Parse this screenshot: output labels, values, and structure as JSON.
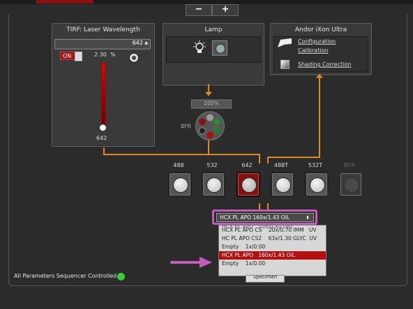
{
  "colors": {
    "accent": "#e08a1e",
    "highlight": "#c35dbb",
    "selected": "#b41010",
    "status_green": "#38d038"
  },
  "toolbar": {
    "minus": "−",
    "plus": "+"
  },
  "laser_panel": {
    "title": "TIRF: Laser Wavelength",
    "wavelength_value": "642",
    "toggle_label": "ON",
    "percent_value": "2.30",
    "percent_unit": "%",
    "slider_value": "642",
    "slider_level_fraction": 0.05,
    "settings_icon": "settings-icon"
  },
  "lamp_panel": {
    "title": "Lamp",
    "lamp_icon": "lightbulb-icon",
    "shutter_icon": "shutter-icon"
  },
  "camera_panel": {
    "title": "Andor iXon Ultra",
    "links": [
      "Configuration",
      "Calibration",
      "Shading Correction"
    ],
    "camera_icon": "camera-icon",
    "shading_icon": "shading-icon"
  },
  "bfr": {
    "percent_select": "100%",
    "label": "BFR"
  },
  "filters": [
    {
      "label": "488",
      "state": "normal"
    },
    {
      "label": "532",
      "state": "normal"
    },
    {
      "label": "642",
      "state": "active"
    },
    {
      "label": "488T",
      "state": "normal"
    },
    {
      "label": "532T",
      "state": "normal"
    },
    {
      "label": "BFR",
      "state": "disabled"
    }
  ],
  "objective": {
    "selected": "HCX PL APO   160x/1.43 OIL",
    "options": [
      "HCX PL APO   10x/0.40 DRY",
      "HCX PL APO CS    20x/0.70 IMM   UV",
      "HC PL APO CS2    63x/1.30 GLYC  UV",
      "Empty    1x/0.00",
      "HCX PL APO   160x/1.43 OIL",
      "Empty    1x/0.00"
    ]
  },
  "specimen_button": "Specimen",
  "status": {
    "text": "All Parameters Sequencer Controlled"
  }
}
